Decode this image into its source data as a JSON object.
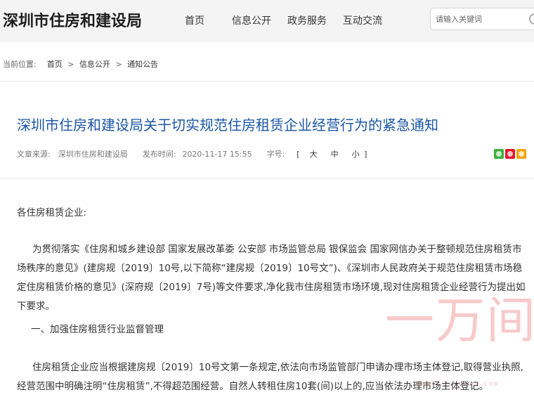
{
  "header": {
    "logo": "深圳市住房和建设局",
    "nav": [
      {
        "label": "首页"
      },
      {
        "label": "信息公开"
      },
      {
        "label": "政务服务"
      },
      {
        "label": "互动交流"
      }
    ],
    "search_placeholder": "请输入关键词"
  },
  "breadcrumb": {
    "prefix": "当前位置:",
    "items": [
      "首页",
      "信息公开",
      "通知公告"
    ],
    "separator": ">"
  },
  "article": {
    "title": "深圳市住房和建设局关于切实规范住房租赁企业经营行为的紧急通知",
    "meta": {
      "source_label": "文章来源:",
      "source": "深圳市住房和建设局",
      "time_label": "发布时间:",
      "time": "2020-11-17 15:55",
      "font_label": "字号:",
      "bracket_open": "[",
      "bracket_close": "]",
      "sizes": [
        "大",
        "中",
        "小"
      ]
    },
    "share_icons": [
      "wechat-share-icon",
      "weibo-share-icon",
      "qzone-share-icon"
    ],
    "salutation": "各住房租赁企业:",
    "body_para": "为贯彻落实《住房和城乡建设部 国家发展改革委 公安部 市场监管总局 银保监会 国家网信办关于整顿规范住房租赁市场秩序的意见》(建房规〔2019〕10号,以下简称“建房规〔2019〕10号文”)、《深圳市人民政府关于规范住房租赁市场稳定住房租赁价格的意见》(深府规〔2019〕7号)等文件要求,净化我市住房租赁市场环境,现对住房租赁企业经营行为提出如下要求。",
    "section_heading": "一、加强住房租赁行业监督管理",
    "detail_para": "住房租赁企业应当根据建房规〔2019〕10号文第一条规定,依法向市场监管部门申请办理市场主体登记,取得营业执照,经营范围中明确注明“住房租赁”,不得超范围经营。自然人转租住房10套(间)以上的,应当依法办理市场主体登记。"
  },
  "watermark": {
    "text": "一万间",
    "url": "www.1wanjian.com"
  },
  "colors": {
    "title": "#1a56a5",
    "header_bg": "#f4f4f4",
    "watermark": "#e83c3c"
  }
}
